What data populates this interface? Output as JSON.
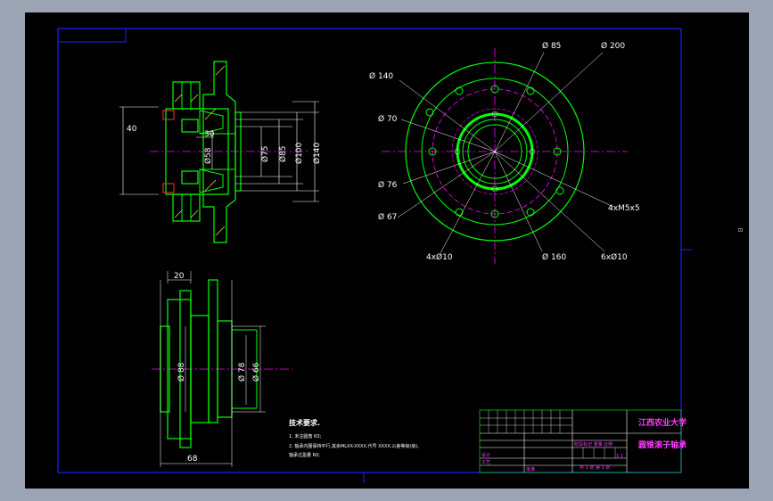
{
  "colors": {
    "background": "#000000",
    "border": "#2020ff",
    "part": "#00ff00",
    "dim": "#00ffff",
    "center": "#ff00ff",
    "text": "#ffffff",
    "title": "#ff3cff",
    "frame": "#9ba4b3"
  },
  "top_view_dims": {
    "d40": "40",
    "d30": "30",
    "d58": "Ø58",
    "d75": "Ø75",
    "d85": "Ø85",
    "d100": "Ø100",
    "d140": "Ø140"
  },
  "front_view_dims": {
    "d85": "Ø 85",
    "d200": "Ø 200",
    "d140": "Ø 140",
    "d70": "Ø 70",
    "d76": "Ø 76",
    "d67": "Ø 67",
    "holes_4x10": "4xØ10",
    "d160": "Ø 160",
    "holes_6x10": "6xØ10",
    "thread": "4xM5x5"
  },
  "bottom_view_dims": {
    "d20": "20",
    "d88": "Ø 88",
    "d78": "Ø 78",
    "d66": "Ø 66",
    "d68": "68"
  },
  "tech_requirements": {
    "heading": "技术要求.",
    "line1": "1. 未注圆角 R3;",
    "line2": "2. 轴承内圈保持平行,其余MLXX-XXXX,代号 XXXX,公差等级(级),",
    "line3": "   轴承过盈量 R0;"
  },
  "title_block": {
    "school": "江西农业大学",
    "part_name": "圆锥滚子轴承",
    "scale": "1:1",
    "sheet": "共 1 张 第 1 张",
    "row_label_1": "设计",
    "row_label_2": "工艺",
    "row_label_3": "批准",
    "mark_labels": "阶段标记  重量  比例"
  },
  "side_marker": "⊡"
}
